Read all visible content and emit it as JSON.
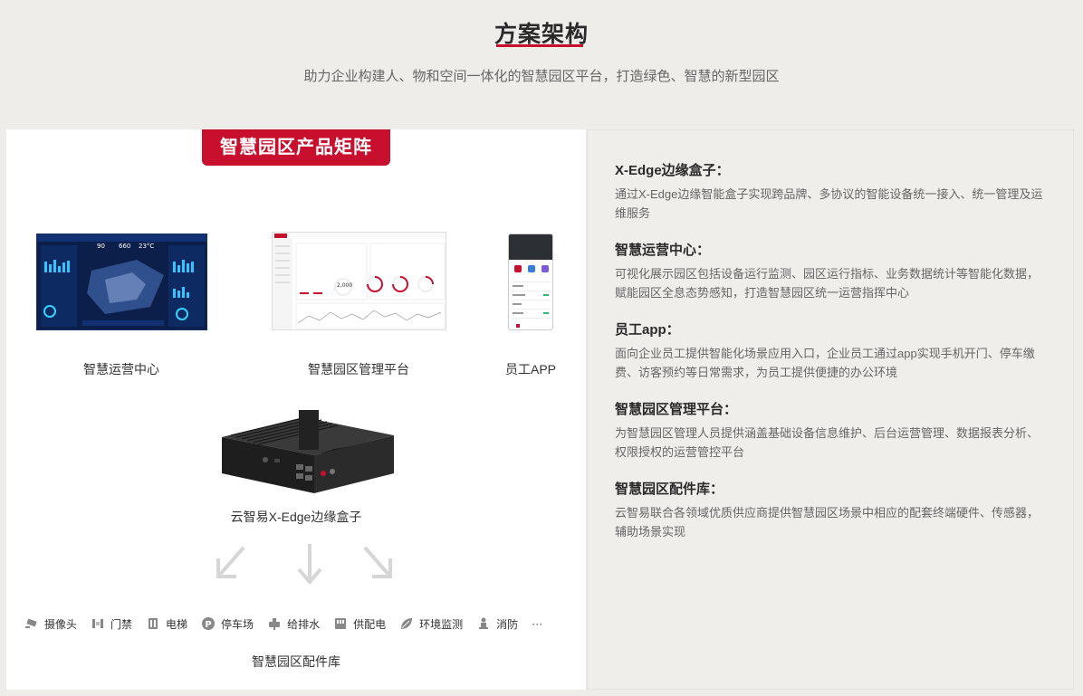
{
  "header": {
    "title": "方案架构",
    "subtitle": "助力企业构建人、物和空间一体化的智慧园区平台，打造绿色、智慧的新型园区"
  },
  "matrix": {
    "badge": "智慧园区产品矩阵",
    "products": [
      {
        "label": "智慧运营中心"
      },
      {
        "label": "智慧园区管理平台"
      },
      {
        "label": "员工APP"
      }
    ],
    "dashboard": {
      "stats": [
        "90",
        "660",
        "23°C"
      ]
    },
    "mgmt": {
      "value": "2,000"
    },
    "box_label": "云智易X-Edge边缘盒子",
    "accessories": [
      {
        "label": "摄像头",
        "icon": "camera-icon"
      },
      {
        "label": "门禁",
        "icon": "door-access-icon"
      },
      {
        "label": "电梯",
        "icon": "elevator-icon"
      },
      {
        "label": "停车场",
        "icon": "parking-icon"
      },
      {
        "label": "给排水",
        "icon": "water-icon"
      },
      {
        "label": "供配电",
        "icon": "power-icon"
      },
      {
        "label": "环境监测",
        "icon": "leaf-icon"
      },
      {
        "label": "消防",
        "icon": "fire-icon"
      }
    ],
    "more": "···",
    "library_label": "智慧园区配件库"
  },
  "descriptions": [
    {
      "title": "X-Edge边缘盒子：",
      "text": "通过X-Edge边缘智能盒子实现跨品牌、多协议的智能设备统一接入、统一管理及运维服务"
    },
    {
      "title": "智慧运营中心：",
      "text": "可视化展示园区包括设备运行监测、园区运行指标、业务数据统计等智能化数据，赋能园区全息态势感知，打造智慧园区统一运营指挥中心"
    },
    {
      "title": "员工app：",
      "text": "面向企业员工提供智能化场景应用入口，企业员工通过app实现手机开门、停车缴费、访客预约等日常需求，为员工提供便捷的办公环境"
    },
    {
      "title": "智慧园区管理平台：",
      "text": "为智慧园区管理人员提供涵盖基础设备信息维护、后台运营管理、数据报表分析、权限授权的运营管控平台"
    },
    {
      "title": "智慧园区配件库：",
      "text": "云智易联合各领域优质供应商提供智慧园区场景中相应的配套终端硬件、传感器，辅助场景实现"
    }
  ],
  "colors": {
    "brand_red": "#c8102e",
    "page_bg": "#efedea"
  }
}
